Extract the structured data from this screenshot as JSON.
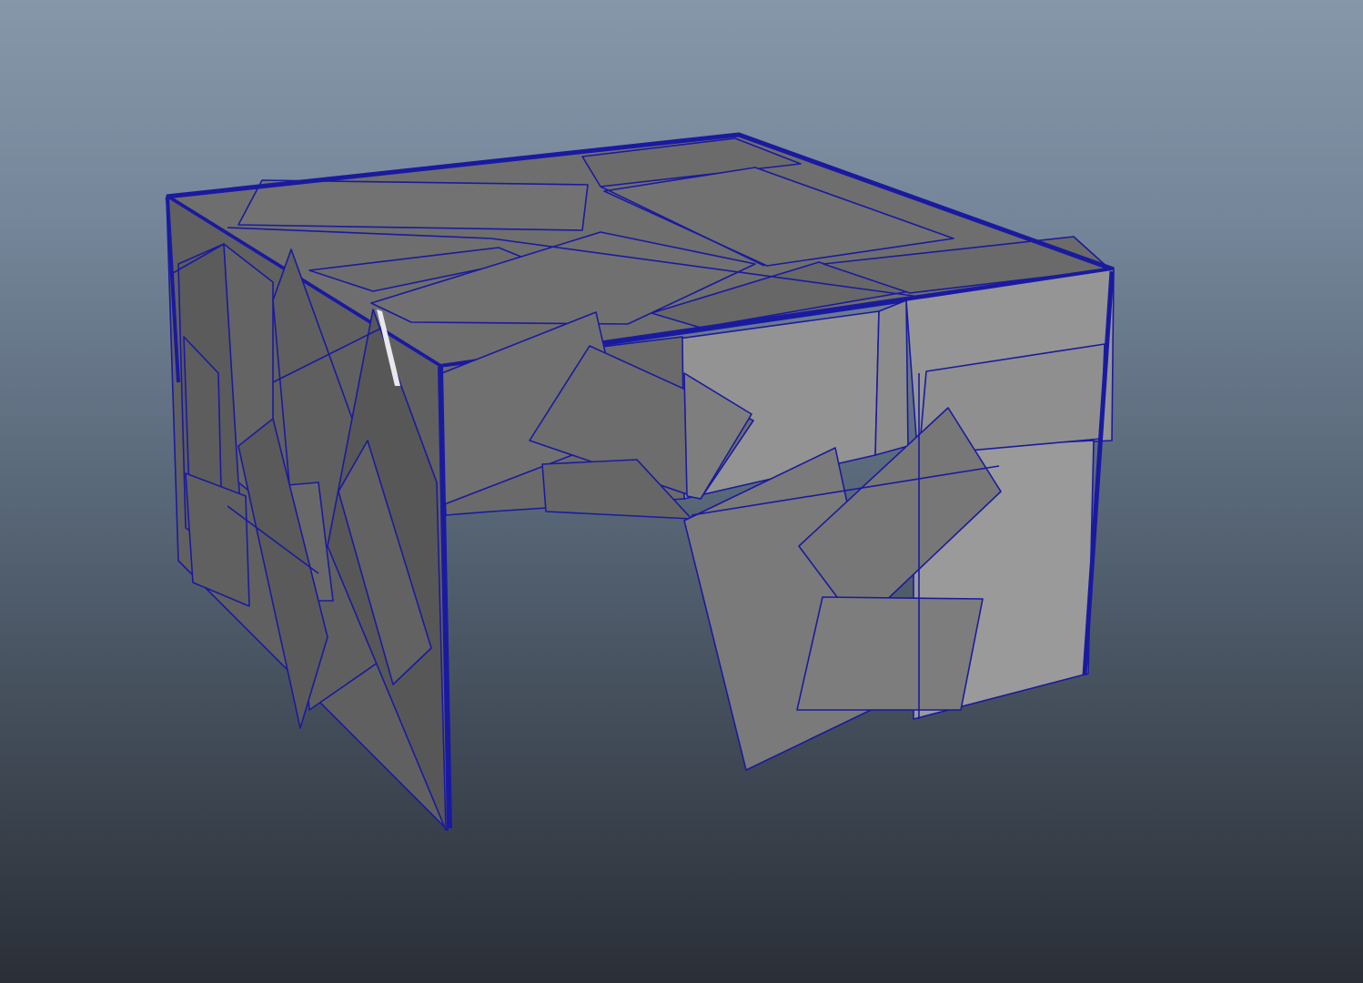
{
  "viewport": {
    "type": "3d-viewport",
    "shading": "wireframe-on-shaded"
  },
  "scene": {
    "model": "fractured-box",
    "object_selected": true
  },
  "colors": {
    "background_top": "#8797aa",
    "background_bottom": "#2a2f37",
    "wireframe": "#1a1aa0",
    "face_light": "#9a9a9a",
    "face_mid": "#6f6f6f",
    "face_dark": "#555555"
  }
}
